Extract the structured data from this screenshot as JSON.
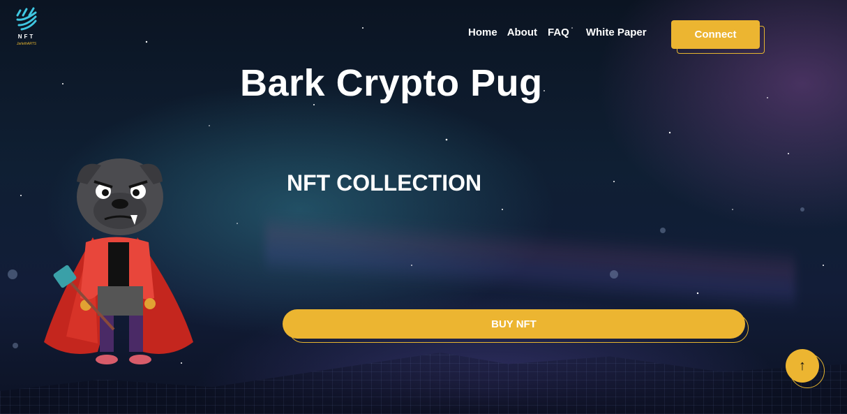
{
  "logo": {
    "text": "NFT",
    "subtext": "JarlethARTS"
  },
  "nav": {
    "items": [
      "Home",
      "About",
      "FAQ",
      "White Paper"
    ],
    "connect_label": "Connect"
  },
  "hero": {
    "title": "Bark Crypto Pug",
    "subtitle": "NFT COLLECTION",
    "buy_label": "BUY NFT"
  },
  "scroll_top": {
    "label": "↑"
  },
  "colors": {
    "accent": "#ecb531",
    "text": "#ffffff",
    "logo_cyan": "#3fc6e0"
  },
  "icons": {
    "logo": "nft-logo-icon",
    "scroll_top": "arrow-up-icon",
    "character": "pug-character-illustration"
  }
}
